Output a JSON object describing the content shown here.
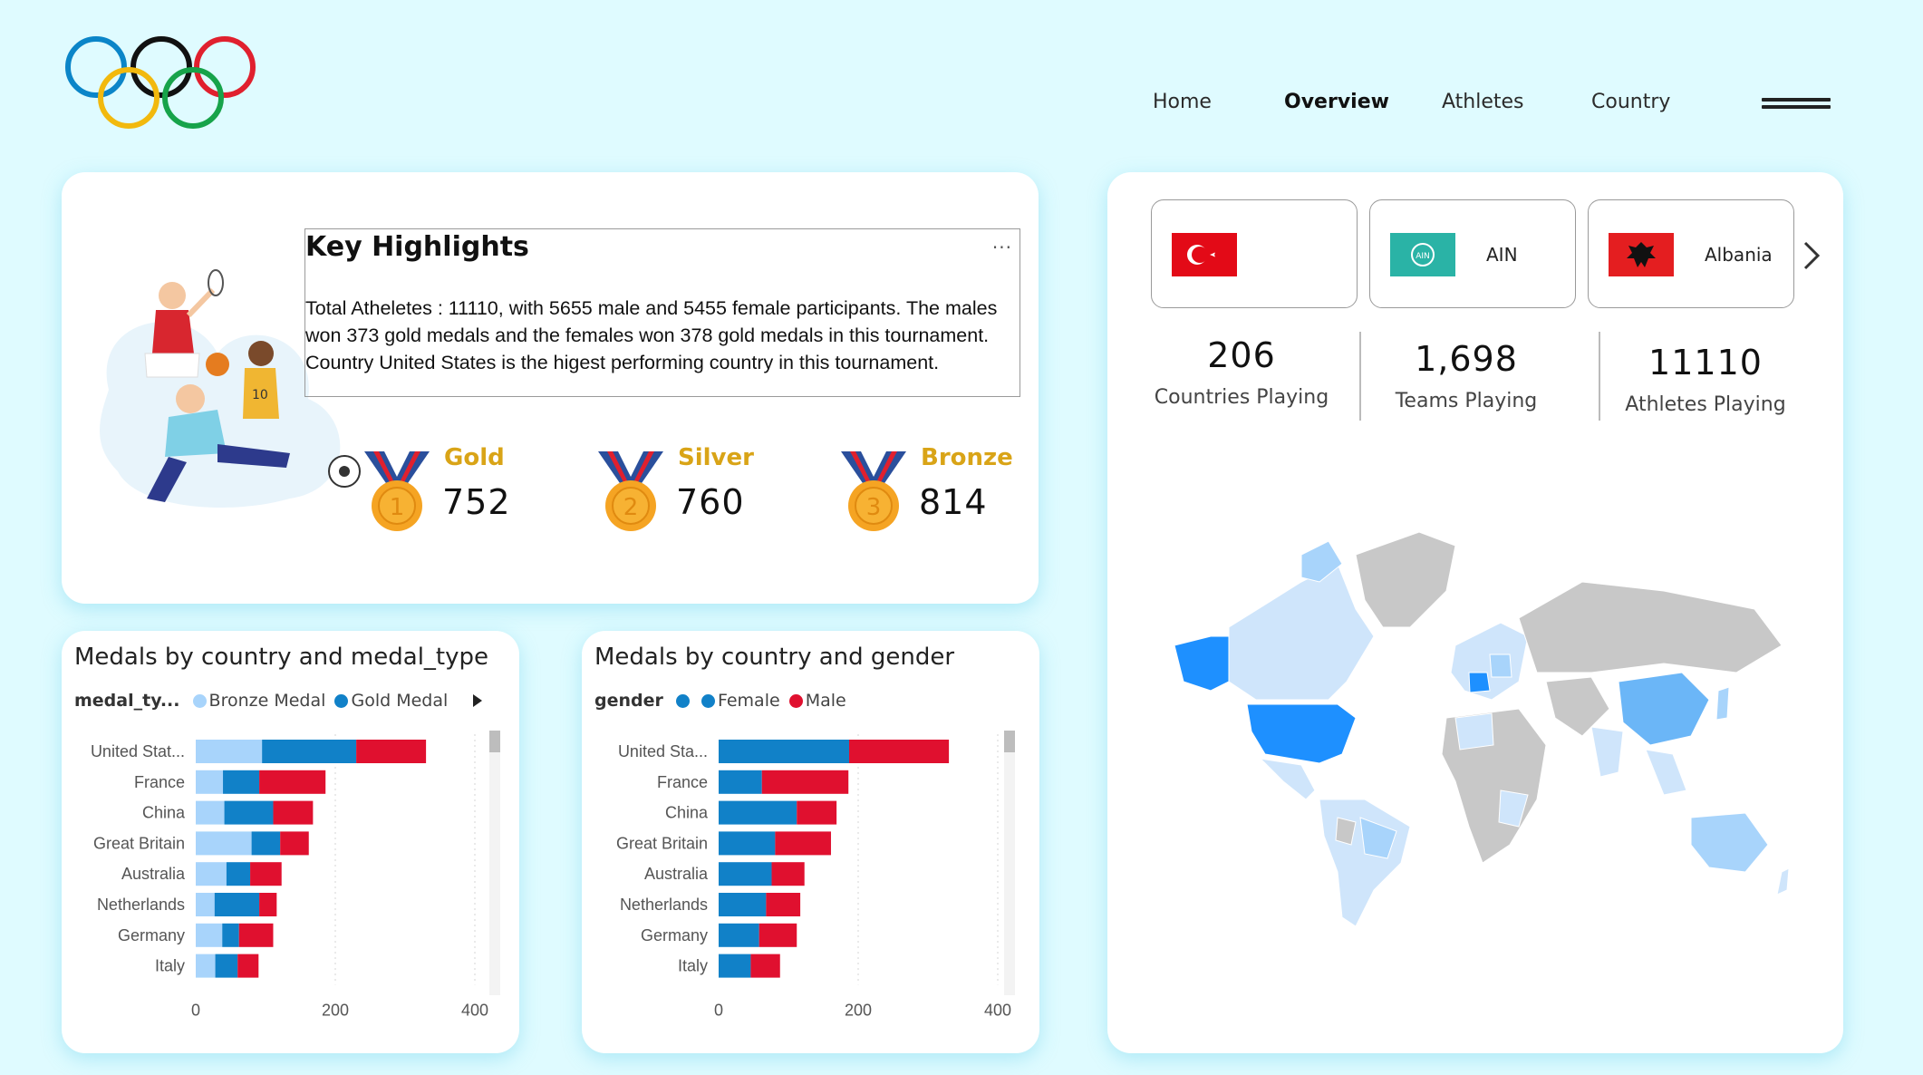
{
  "app": {
    "logo_icon": "olympic-rings-icon",
    "ring_colors": [
      "#0b85c8",
      "#111111",
      "#e0202e",
      "#f2b90d",
      "#17a34a"
    ]
  },
  "nav": {
    "items": [
      {
        "label": "Home",
        "active": false
      },
      {
        "label": "Overview",
        "active": true
      },
      {
        "label": "Athletes",
        "active": false
      },
      {
        "label": "Country",
        "active": false
      }
    ],
    "menu_icon": "hamburger-menu-icon"
  },
  "highlights": {
    "title": "Key Highlights",
    "more_options": "...",
    "text": "Total Atheletes : 11110, with 5655 male and 5455 female participants. The males won 373 gold medals and the females won 378 gold medals in this tournament. Country United States is the higest performing country in this tournament.",
    "illustration_icon": "athletes-illustration-icon",
    "medals": [
      {
        "label": "Gold",
        "value": "752",
        "rank": "1"
      },
      {
        "label": "Silver",
        "value": "760",
        "rank": "2"
      },
      {
        "label": "Bronze",
        "value": "814",
        "rank": "3"
      }
    ]
  },
  "countries": {
    "cards": [
      {
        "name": "",
        "flag_icon": "turkey-flag-icon"
      },
      {
        "name": "AIN",
        "flag_icon": "ain-flag-icon",
        "flag_text": "AIN"
      },
      {
        "name": "Albania",
        "flag_icon": "albania-flag-icon"
      }
    ],
    "next_icon": "chevron-right-icon"
  },
  "stats": [
    {
      "value": "206",
      "label": "Countries Playing"
    },
    {
      "value": "1,698",
      "label": "Teams Playing"
    },
    {
      "value": "11110",
      "label": "Athletes Playing"
    }
  ],
  "map": {
    "icon": "world-map-icon"
  },
  "colors": {
    "bronze_medal": "#a8d4fb",
    "gold_medal": "#1181c8",
    "silver_medal": "#e0102f",
    "female": "#1181c8",
    "male": "#e0102f"
  },
  "chart_data": [
    {
      "type": "bar",
      "orientation": "horizontal",
      "stacked": true,
      "title": "Medals by country and medal_type",
      "legend_title": "medal_ty...",
      "categories": [
        "United Stat...",
        "France",
        "China",
        "Great Britain",
        "Australia",
        "Netherlands",
        "Germany",
        "Italy"
      ],
      "series": [
        {
          "name": "Bronze Medal",
          "color": "#a8d4fb",
          "values": [
            95,
            39,
            41,
            80,
            44,
            27,
            38,
            28
          ]
        },
        {
          "name": "Gold Medal",
          "color": "#1181c8",
          "values": [
            135,
            52,
            70,
            41,
            34,
            64,
            24,
            32
          ]
        },
        {
          "name": "",
          "color": "#e0102f",
          "values": [
            100,
            95,
            57,
            41,
            45,
            25,
            49,
            30
          ]
        }
      ],
      "xticks": [
        "0",
        "200",
        "400"
      ],
      "xlim": [
        0,
        400
      ]
    },
    {
      "type": "bar",
      "orientation": "horizontal",
      "stacked": true,
      "title": "Medals by country and gender",
      "legend_title": "gender",
      "categories": [
        "United Sta...",
        "France",
        "China",
        "Great Britain",
        "Australia",
        "Netherlands",
        "Germany",
        "Italy"
      ],
      "series": [
        {
          "name": "",
          "color": "#1181c8",
          "values": [
            0,
            0,
            0,
            0,
            0,
            0,
            0,
            0
          ]
        },
        {
          "name": "Female",
          "color": "#1181c8",
          "values": [
            187,
            62,
            112,
            81,
            76,
            68,
            58,
            46
          ]
        },
        {
          "name": "Male",
          "color": "#e0102f",
          "values": [
            143,
            124,
            57,
            80,
            47,
            49,
            54,
            42
          ]
        }
      ],
      "xticks": [
        "0",
        "200",
        "400"
      ],
      "xlim": [
        0,
        400
      ]
    }
  ]
}
